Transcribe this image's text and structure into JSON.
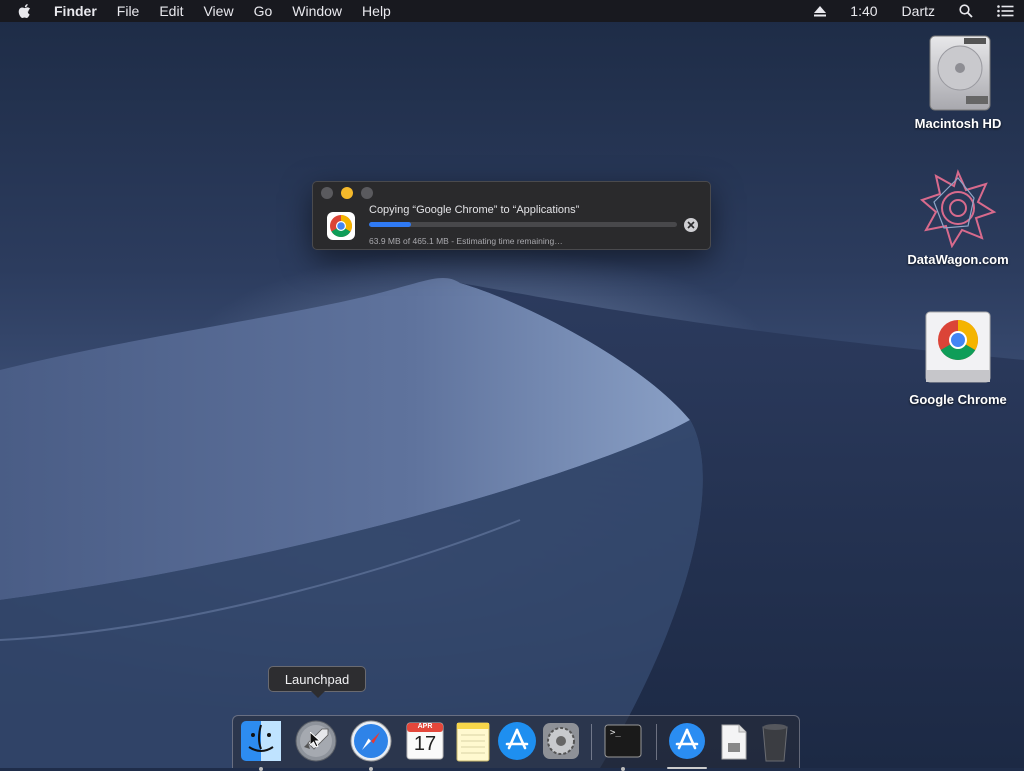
{
  "menubar": {
    "app_name": "Finder",
    "menus": [
      "File",
      "Edit",
      "View",
      "Go",
      "Window",
      "Help"
    ],
    "clock": "1:40",
    "user": "Dartz",
    "icons": [
      "apple-icon",
      "eject-icon",
      "spotlight-search-icon",
      "notification-center-icon"
    ]
  },
  "desktop_icons": [
    {
      "label": "Macintosh HD",
      "icon": "hard-drive-icon"
    },
    {
      "label": "DataWagon.com",
      "icon": "datawagon-icon"
    },
    {
      "label": "Google Chrome",
      "icon": "chrome-disk-image-icon"
    }
  ],
  "copy_window": {
    "title": "Copying “Google Chrome” to “Applications”",
    "status": "63.9 MB of 465.1 MB - Estimating time remaining…",
    "progress_fraction": 0.137,
    "accent": "#2f7af5"
  },
  "tooltip": {
    "text": "Launchpad"
  },
  "dock": {
    "items": [
      "Finder",
      "Launchpad",
      "Safari",
      "Calendar",
      "Notes",
      "App Store",
      "System Preferences",
      "Terminal",
      "Applications",
      "Downloads",
      "Trash"
    ],
    "calendar": {
      "month": "APR",
      "day": "17"
    },
    "terminal_prompt": ">_"
  },
  "colors": {
    "close": "#5a5a5e",
    "minimize": "#f5b92b",
    "zoom": "#5a5a5e"
  }
}
